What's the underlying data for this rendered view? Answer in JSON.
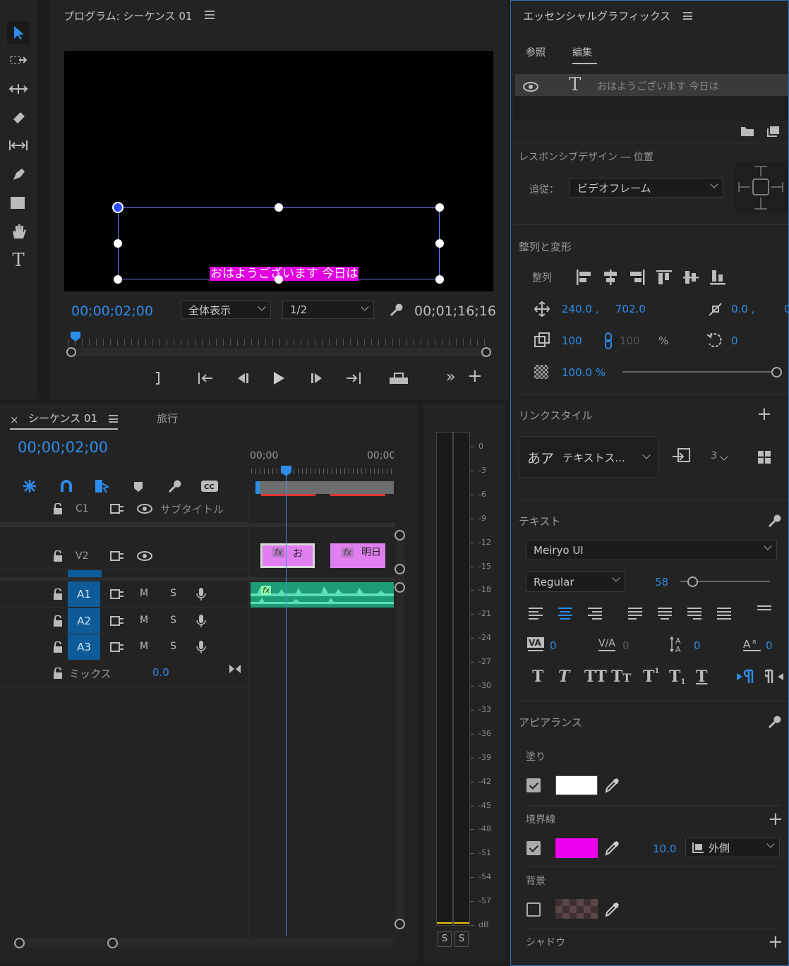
{
  "program": {
    "title": "プログラム: シーケンス 01",
    "caption": "おはようございます 今日は",
    "timecode_current": "00;00;02;00",
    "zoom": "全体表示",
    "resolution": "1/2",
    "timecode_duration": "00;01;16;16"
  },
  "timeline": {
    "tab_active": "シーケンス 01",
    "tab_other": "旅行",
    "timecode": "00;00;02;00",
    "ruler": [
      "00;00",
      "00;00"
    ],
    "tracks": [
      {
        "id": "C1",
        "name": "サブタイトル"
      },
      {
        "id": "V2"
      },
      {
        "id": "A1",
        "m": "M",
        "s": "S"
      },
      {
        "id": "A2",
        "m": "M",
        "s": "S"
      },
      {
        "id": "A3",
        "m": "M",
        "s": "S"
      }
    ],
    "mix_label": "ミックス",
    "mix_value": "0.0",
    "clips": [
      {
        "label": "お"
      },
      {
        "label": "明日"
      }
    ],
    "fx_label": "fx"
  },
  "meter": {
    "scale": [
      "0",
      "-3",
      "-6",
      "-9",
      "-12",
      "-15",
      "-18",
      "-21",
      "-24",
      "-27",
      "-30",
      "-33",
      "-36",
      "-39",
      "-42",
      "-45",
      "-48",
      "-51",
      "-54",
      "-57",
      "dB"
    ],
    "solo_left": "S",
    "solo_right": "S"
  },
  "eg": {
    "title": "エッセンシャルグラフィックス",
    "tab_browse": "参照",
    "tab_edit": "編集",
    "layer_text": "おはようございます 今日は",
    "responsive_title": "レスポンシブデザイン ― 位置",
    "follow_label": "追従：",
    "follow_value": "ビデオフレーム",
    "align_title": "整列と変形",
    "align_label": "整列",
    "pos_x": "240.0 ,",
    "pos_y": "702.0",
    "anchor_x": "0.0 ,",
    "anchor_y": "0",
    "scale": "100",
    "scale_locked": "100",
    "percent": "%",
    "rotation": "0",
    "opacity": "100.0 %",
    "linked_style_title": "リンクスタイル",
    "style_sample": "あア",
    "style_name": "テキストス...",
    "style_count": "3",
    "text_title": "テキスト",
    "font": "Meiryo UI",
    "font_style": "Regular",
    "font_size": "58",
    "kerning": "0",
    "tracking": "0",
    "leading": "0",
    "baseline": "0",
    "appearance_title": "アピアランス",
    "fill_label": "塗り",
    "stroke_label": "境界線",
    "stroke_width": "10.0",
    "stroke_type": "外側",
    "bg_label": "背景",
    "shadow_label": "シャドウ",
    "fill_color": "#ffffff",
    "stroke_color": "#ee00ee",
    "accent": "#2d8ceb"
  }
}
